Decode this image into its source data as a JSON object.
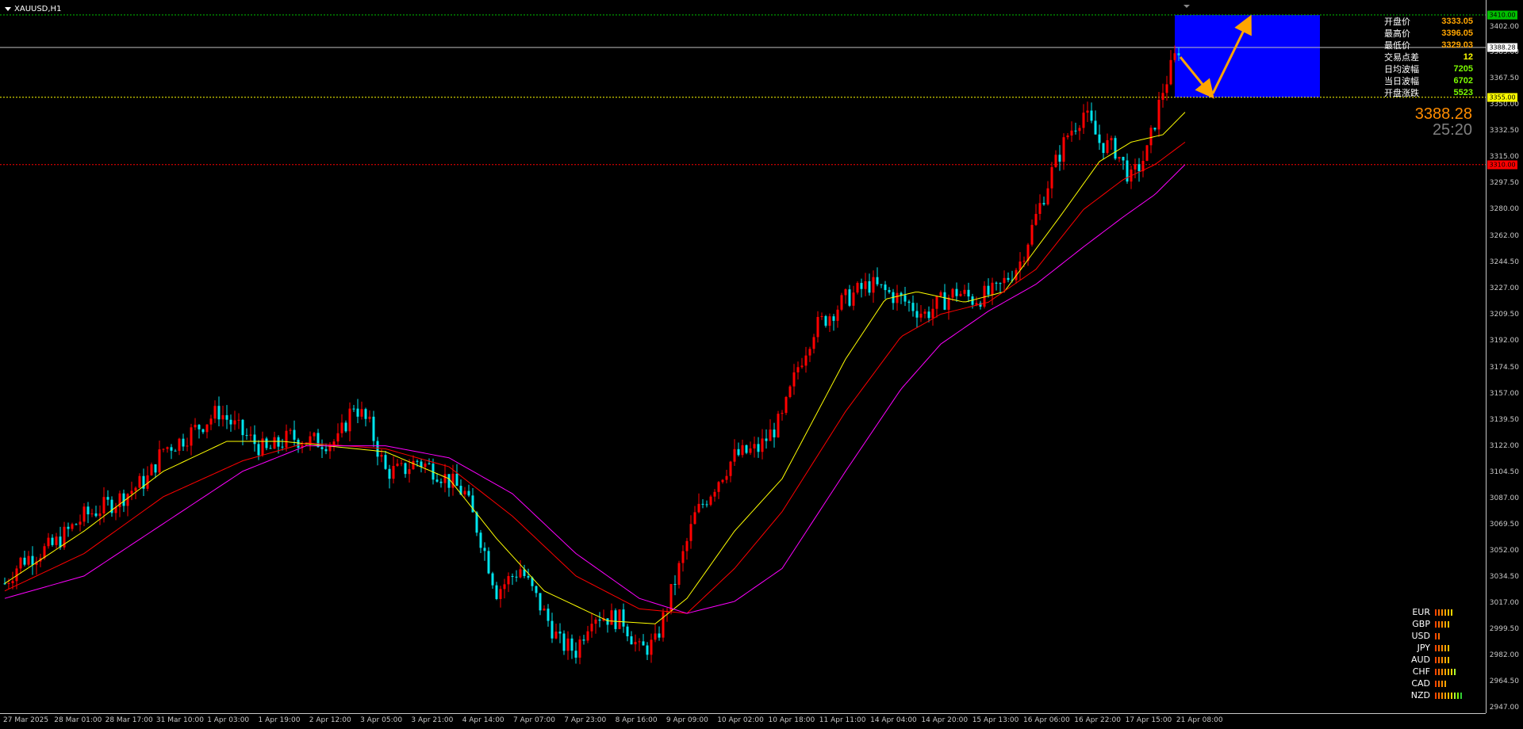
{
  "window": {
    "title": "XAUUSD,H1"
  },
  "info_panel": [
    {
      "label": "开盘价",
      "value": "3333.05",
      "color": "#ffa500"
    },
    {
      "label": "最高价",
      "value": "3396.05",
      "color": "#ffa500"
    },
    {
      "label": "最低价",
      "value": "3329.03",
      "color": "#ffa500"
    },
    {
      "label": "交易点差",
      "value": "12",
      "color": "#ffff00"
    },
    {
      "label": "日均波幅",
      "value": "7205",
      "color": "#7cfc00"
    },
    {
      "label": "当日波幅",
      "value": "6702",
      "color": "#7cfc00"
    },
    {
      "label": "开盘涨跌",
      "value": "5523",
      "color": "#7cfc00"
    }
  ],
  "current_price": "3388.28",
  "bar_timer": "25:20",
  "price_axis": {
    "labels": [
      "3402.00",
      "3385.00",
      "3367.50",
      "3350.00",
      "3332.50",
      "3315.00",
      "3297.50",
      "3280.00",
      "3262.00",
      "3244.50",
      "3227.00",
      "3209.50",
      "3192.00",
      "3174.50",
      "3157.00",
      "3139.50",
      "3122.00",
      "3104.50",
      "3087.00",
      "3069.50",
      "3052.00",
      "3034.50",
      "3017.00",
      "2999.50",
      "2982.00",
      "2964.50",
      "2947.00"
    ],
    "tags": [
      {
        "value": "3410.00",
        "bg": "#00c000",
        "fg": "#000000"
      },
      {
        "value": "3388.28",
        "bg": "#ffffff",
        "fg": "#000000"
      },
      {
        "value": "3355.00",
        "bg": "#ffff00",
        "fg": "#000000"
      },
      {
        "value": "3310.00",
        "bg": "#ff0000",
        "fg": "#000000"
      }
    ]
  },
  "time_axis": [
    "27 Mar 2025",
    "28 Mar 01:00",
    "28 Mar 17:00",
    "31 Mar 10:00",
    "1 Apr 03:00",
    "1 Apr 19:00",
    "2 Apr 12:00",
    "3 Apr 05:00",
    "3 Apr 21:00",
    "4 Apr 14:00",
    "7 Apr 07:00",
    "7 Apr 23:00",
    "8 Apr 16:00",
    "9 Apr 09:00",
    "10 Apr 02:00",
    "10 Apr 18:00",
    "11 Apr 11:00",
    "14 Apr 04:00",
    "14 Apr 20:00",
    "15 Apr 13:00",
    "16 Apr 06:00",
    "16 Apr 22:00",
    "17 Apr 15:00",
    "21 Apr 08:00"
  ],
  "levels": [
    {
      "price": 3410.0,
      "color": "#00c000",
      "style": "dotted"
    },
    {
      "price": 3388.28,
      "color": "#c0c0c0",
      "style": "solid"
    },
    {
      "price": 3355.0,
      "color": "#ffff00",
      "style": "dotted"
    },
    {
      "price": 3310.0,
      "color": "#ff0000",
      "style": "dotted"
    }
  ],
  "zone": {
    "price_top": 3410.0,
    "price_bottom": 3355.0,
    "color": "#0000ff"
  },
  "arrow_color": "#ffa500",
  "colors": {
    "bull": "#ff0000",
    "bear": "#00e5ee",
    "ma_fast": "#ffff00",
    "ma_mid": "#ff0000",
    "ma_slow": "#ff00ff"
  },
  "currency_strength": [
    {
      "currency": "EUR",
      "strength": 6
    },
    {
      "currency": "GBP",
      "strength": 5
    },
    {
      "currency": "USD",
      "strength": 2
    },
    {
      "currency": "JPY",
      "strength": 5
    },
    {
      "currency": "AUD",
      "strength": 5
    },
    {
      "currency": "CHF",
      "strength": 7
    },
    {
      "currency": "CAD",
      "strength": 4
    },
    {
      "currency": "NZD",
      "strength": 9
    }
  ],
  "chart_data": {
    "type": "candlestick",
    "symbol": "XAUUSD",
    "timeframe": "H1",
    "ylim": [
      2940,
      3420
    ],
    "price_path": [
      [
        0,
        3030
      ],
      [
        20,
        3045
      ],
      [
        60,
        3055
      ],
      [
        100,
        3075
      ],
      [
        140,
        3085
      ],
      [
        180,
        3100
      ],
      [
        200,
        3120
      ],
      [
        220,
        3125
      ],
      [
        270,
        3145
      ],
      [
        300,
        3130
      ],
      [
        330,
        3118
      ],
      [
        360,
        3128
      ],
      [
        380,
        3125
      ],
      [
        400,
        3125
      ],
      [
        420,
        3125
      ],
      [
        440,
        3150
      ],
      [
        460,
        3135
      ],
      [
        480,
        3105
      ],
      [
        500,
        3105
      ],
      [
        520,
        3112
      ],
      [
        545,
        3105
      ],
      [
        580,
        3090
      ],
      [
        600,
        3060
      ],
      [
        620,
        3025
      ],
      [
        650,
        3040
      ],
      [
        680,
        3010
      ],
      [
        700,
        2990
      ],
      [
        720,
        2985
      ],
      [
        740,
        3010
      ],
      [
        780,
        3005
      ],
      [
        800,
        2985
      ],
      [
        820,
        2990
      ],
      [
        850,
        3040
      ],
      [
        870,
        3075
      ],
      [
        900,
        3100
      ],
      [
        920,
        3115
      ],
      [
        950,
        3120
      ],
      [
        980,
        3140
      ],
      [
        1000,
        3175
      ],
      [
        1020,
        3200
      ],
      [
        1060,
        3220
      ],
      [
        1090,
        3230
      ],
      [
        1110,
        3225
      ],
      [
        1130,
        3220
      ],
      [
        1160,
        3210
      ],
      [
        1180,
        3218
      ],
      [
        1200,
        3225
      ],
      [
        1220,
        3220
      ],
      [
        1250,
        3225
      ],
      [
        1280,
        3245
      ],
      [
        1300,
        3275
      ],
      [
        1320,
        3305
      ],
      [
        1340,
        3330
      ],
      [
        1360,
        3345
      ],
      [
        1380,
        3325
      ],
      [
        1400,
        3320
      ],
      [
        1420,
        3300
      ],
      [
        1440,
        3318
      ],
      [
        1460,
        3360
      ],
      [
        1480,
        3388
      ]
    ],
    "ma_fast": [
      [
        0,
        3030
      ],
      [
        100,
        3065
      ],
      [
        200,
        3105
      ],
      [
        280,
        3125
      ],
      [
        350,
        3125
      ],
      [
        480,
        3118
      ],
      [
        560,
        3100
      ],
      [
        620,
        3060
      ],
      [
        680,
        3025
      ],
      [
        760,
        3005
      ],
      [
        820,
        3003
      ],
      [
        860,
        3020
      ],
      [
        920,
        3065
      ],
      [
        980,
        3100
      ],
      [
        1060,
        3180
      ],
      [
        1110,
        3220
      ],
      [
        1150,
        3225
      ],
      [
        1210,
        3218
      ],
      [
        1260,
        3225
      ],
      [
        1330,
        3275
      ],
      [
        1380,
        3312
      ],
      [
        1420,
        3325
      ],
      [
        1460,
        3330
      ],
      [
        1488,
        3345
      ]
    ],
    "ma_mid": [
      [
        0,
        3025
      ],
      [
        100,
        3050
      ],
      [
        200,
        3088
      ],
      [
        300,
        3112
      ],
      [
        380,
        3124
      ],
      [
        480,
        3120
      ],
      [
        560,
        3108
      ],
      [
        640,
        3075
      ],
      [
        720,
        3035
      ],
      [
        800,
        3013
      ],
      [
        860,
        3010
      ],
      [
        920,
        3040
      ],
      [
        980,
        3078
      ],
      [
        1060,
        3145
      ],
      [
        1130,
        3195
      ],
      [
        1180,
        3210
      ],
      [
        1240,
        3218
      ],
      [
        1300,
        3240
      ],
      [
        1360,
        3280
      ],
      [
        1410,
        3300
      ],
      [
        1450,
        3310
      ],
      [
        1488,
        3325
      ]
    ],
    "ma_slow": [
      [
        0,
        3020
      ],
      [
        100,
        3035
      ],
      [
        200,
        3070
      ],
      [
        300,
        3105
      ],
      [
        380,
        3122
      ],
      [
        480,
        3122
      ],
      [
        560,
        3114
      ],
      [
        640,
        3090
      ],
      [
        720,
        3050
      ],
      [
        800,
        3020
      ],
      [
        860,
        3010
      ],
      [
        920,
        3018
      ],
      [
        980,
        3040
      ],
      [
        1060,
        3105
      ],
      [
        1130,
        3160
      ],
      [
        1180,
        3190
      ],
      [
        1240,
        3212
      ],
      [
        1300,
        3230
      ],
      [
        1360,
        3255
      ],
      [
        1410,
        3275
      ],
      [
        1450,
        3290
      ],
      [
        1488,
        3310
      ]
    ]
  }
}
